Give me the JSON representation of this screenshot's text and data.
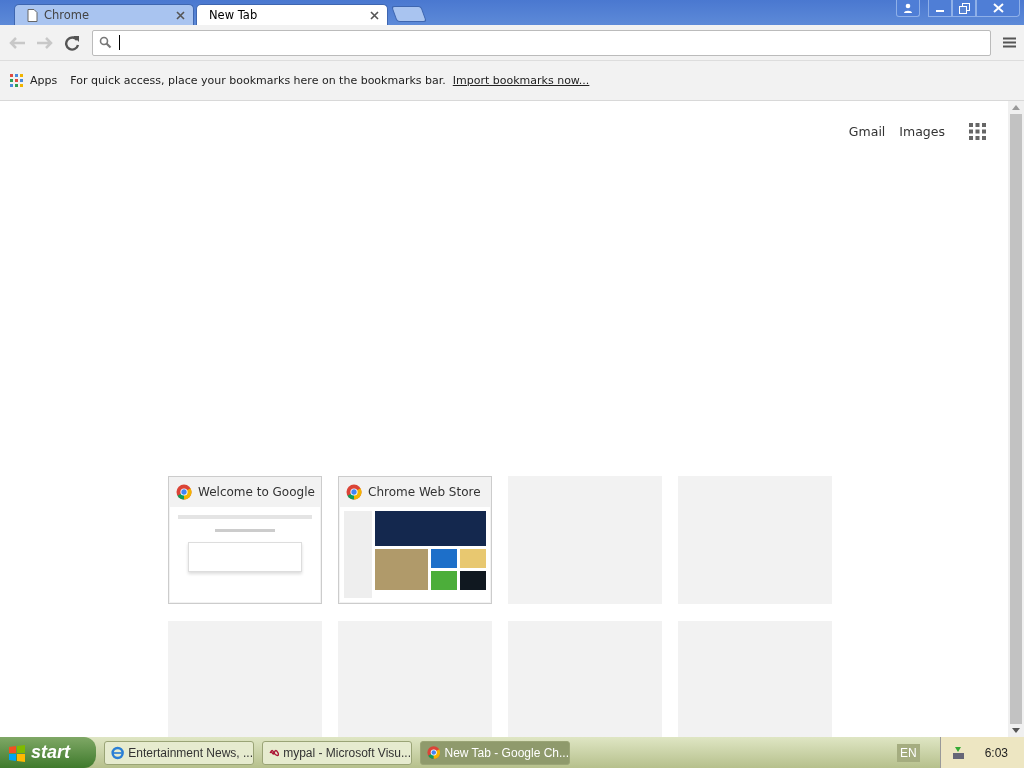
{
  "tabs": [
    {
      "title": "Chrome",
      "selected": false
    },
    {
      "title": "New Tab",
      "selected": true
    }
  ],
  "bookmarks_bar": {
    "apps_label": "Apps",
    "message": "For quick access, place your bookmarks here on the bookmarks bar.",
    "import_link": "Import bookmarks now..."
  },
  "top_links": [
    "Gmail",
    "Images"
  ],
  "tiles": [
    {
      "kind": "thumbnail",
      "title": "Welcome to Google"
    },
    {
      "kind": "thumbnail",
      "title": "Chrome Web Store"
    },
    {
      "kind": "empty"
    },
    {
      "kind": "empty"
    },
    {
      "kind": "empty"
    },
    {
      "kind": "empty"
    },
    {
      "kind": "empty"
    },
    {
      "kind": "empty"
    }
  ],
  "taskbar": {
    "start_label": "start",
    "buttons": [
      {
        "label": "Entertainment News, ...",
        "selected": false
      },
      {
        "label": "mypal - Microsoft Visu...",
        "selected": false
      },
      {
        "label": "New Tab - Google Ch...",
        "selected": true
      }
    ],
    "language": "EN",
    "clock": "6:03"
  }
}
